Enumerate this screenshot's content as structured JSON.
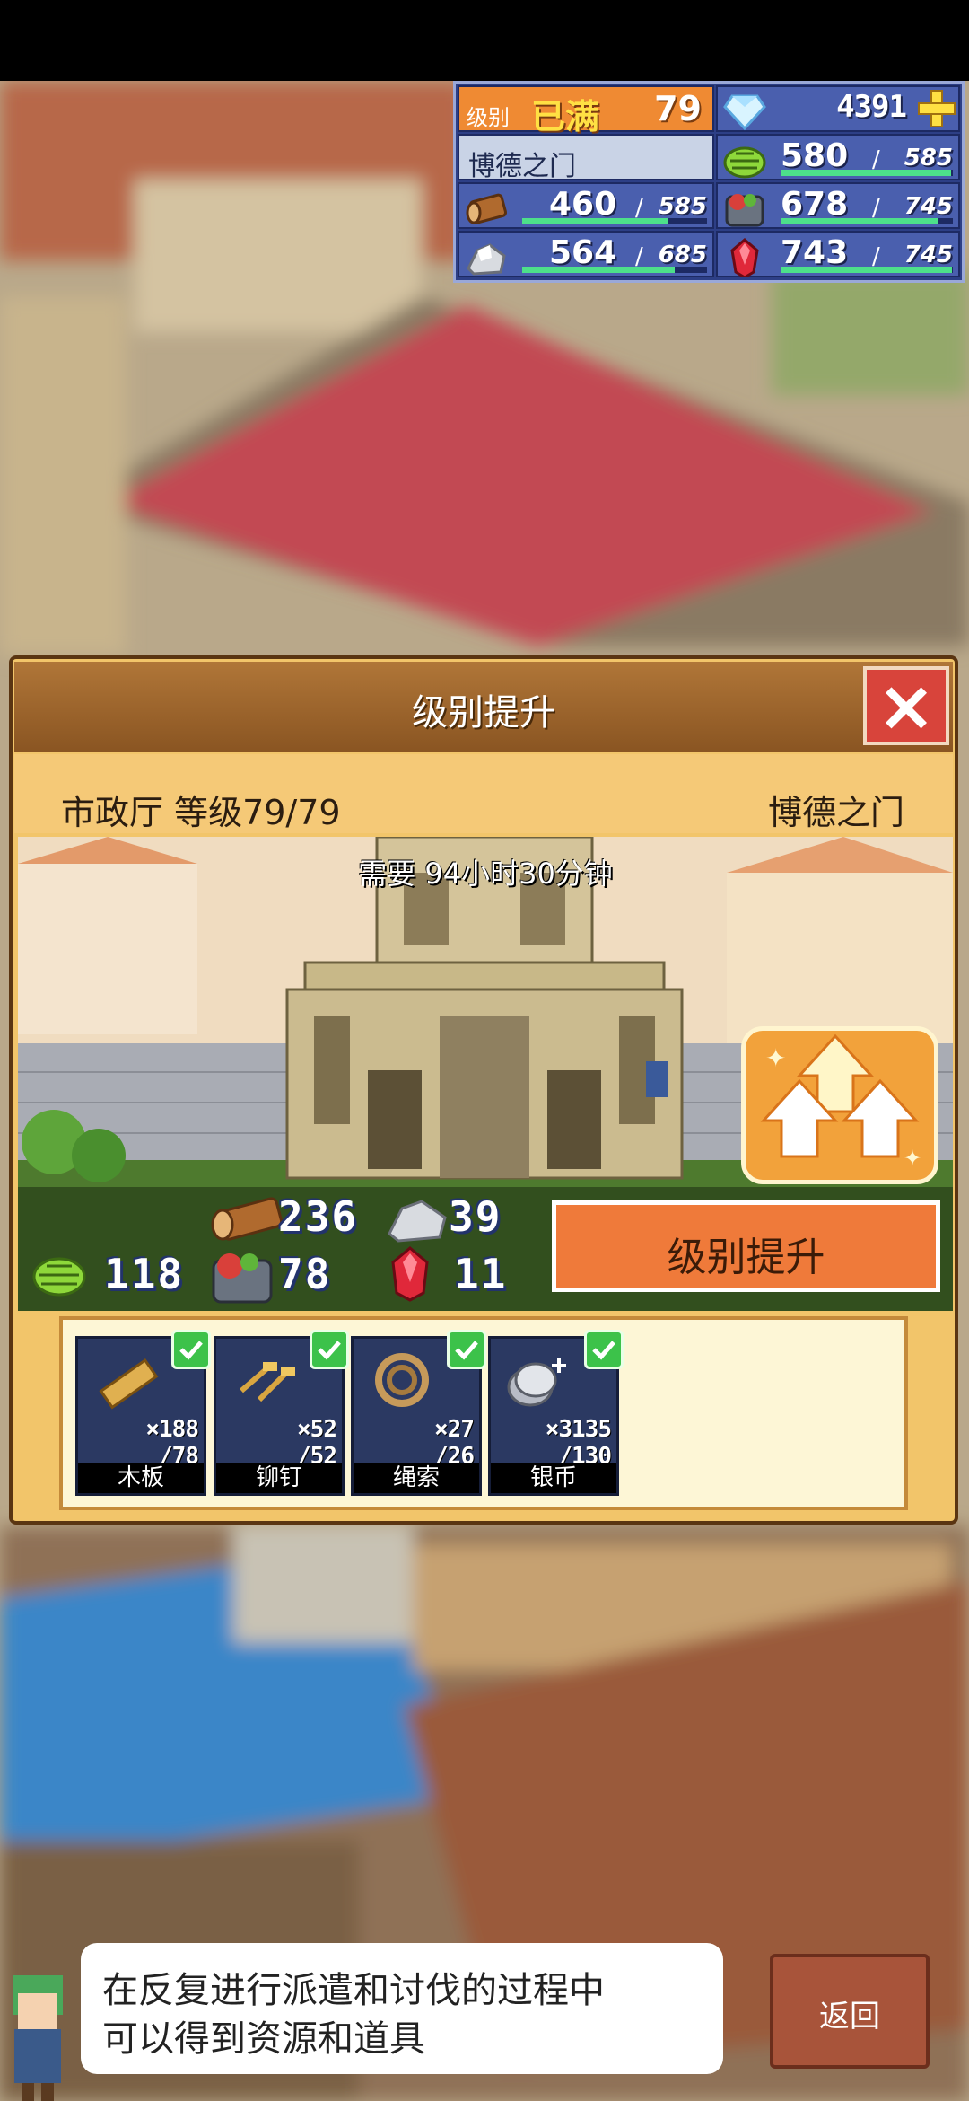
{
  "resources": {
    "level_label": "级别",
    "level_status": "已满",
    "level_value": "79",
    "gems": "4391",
    "town_name": "博德之门",
    "food": {
      "current": "580",
      "max": "585"
    },
    "wood": {
      "current": "460",
      "max": "585"
    },
    "meat": {
      "current": "678",
      "max": "745"
    },
    "ore": {
      "current": "564",
      "max": "685"
    },
    "crystal": {
      "current": "743",
      "max": "745"
    },
    "bar_fill": {
      "food": 0.991,
      "wood": 0.786,
      "meat": 0.91,
      "ore": 0.823,
      "crystal": 0.997
    }
  },
  "dialog": {
    "title": "级别提升",
    "building_info": "市政厅 等级79/79",
    "town_name": "博德之门",
    "time_required": "需要 94小时30分钟",
    "upgrade_button": "级别提升",
    "cost": {
      "wood": "236",
      "ore": "39",
      "food": "118",
      "meat": "78",
      "crystal": "11"
    }
  },
  "materials": [
    {
      "name": "木板",
      "have": "×188",
      "need": "/78"
    },
    {
      "name": "铆钉",
      "have": "×52",
      "need": "/52"
    },
    {
      "name": "绳索",
      "have": "×27",
      "need": "/26"
    },
    {
      "name": "银币",
      "have": "×3135",
      "need": "/130"
    }
  ],
  "hint": {
    "line1": "在反复进行派遣和讨伐的过程中",
    "line2": "可以得到资源和道具"
  },
  "back_button": "返回",
  "icons": {
    "gem": "diamond-icon",
    "add": "plus-icon",
    "food": "grass-icon",
    "wood": "log-icon",
    "meat": "meat-icon",
    "ore": "ore-icon",
    "crystal": "red-crystal-icon",
    "close": "close-icon",
    "check": "check-icon"
  }
}
